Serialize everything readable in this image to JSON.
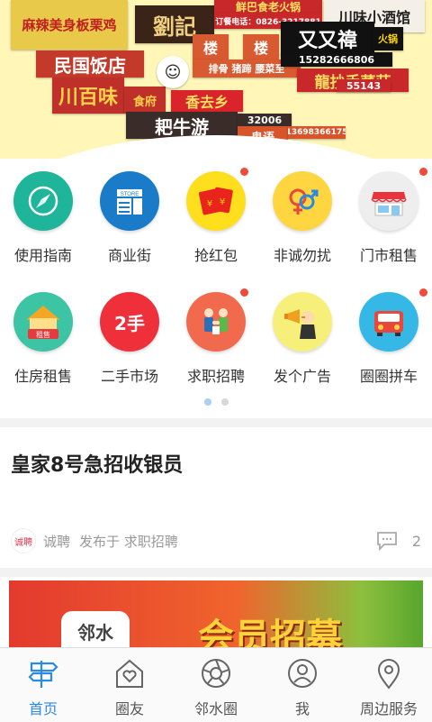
{
  "banner": {
    "signs": [
      {
        "text": "麻辣美身板栗鸡",
        "bg": "#e8c94a",
        "fg": "#c02020"
      },
      {
        "text": "劉記",
        "bg": "#3a2418",
        "fg": "#f0d080"
      },
      {
        "text": "鲜巴食老火锅",
        "bg": "#c8282a",
        "fg": "#ffe060"
      },
      {
        "text": "订餐电话：0826-3217881",
        "bg": "#c8282a",
        "fg": "#fff"
      },
      {
        "text": "川味小酒馆",
        "bg": "#f4f0e8",
        "fg": "#222"
      },
      {
        "text": "民国饭店",
        "bg": "#c43a2a",
        "fg": "#fff"
      },
      {
        "text": "楼",
        "bg": "#d85a30",
        "fg": "#fff"
      },
      {
        "text": "楼",
        "bg": "#d85a30",
        "fg": "#fff"
      },
      {
        "text": "又又禕",
        "bg": "#111",
        "fg": "#fff"
      },
      {
        "text": "火锅",
        "bg": "#111",
        "fg": "#ffd800"
      },
      {
        "text": "15282666806",
        "bg": "#111",
        "fg": "#fff"
      },
      {
        "text": "排骨 猪蹄 腰菜至",
        "bg": "#d85a30",
        "fg": "#fff"
      },
      {
        "text": "龍抄手菜莊",
        "bg": "#c8282a",
        "fg": "#ffe060"
      },
      {
        "text": "川百味",
        "bg": "#c0302a",
        "fg": "#ffd24a"
      },
      {
        "text": "食府",
        "bg": "#c0302a",
        "fg": "#ffd24a"
      },
      {
        "text": "香去乡",
        "bg": "#d8242a",
        "fg": "#ffe060"
      },
      {
        "text": "55143",
        "bg": "#c8282a",
        "fg": "#fff"
      },
      {
        "text": "耙牛游",
        "bg": "#3a2c28",
        "fg": "#fff"
      },
      {
        "text": "32006",
        "bg": "#3a2c28",
        "fg": "#fff"
      },
      {
        "text": "鬼语",
        "bg": "#d8542a",
        "fg": "#fff"
      },
      {
        "text": "13698366175",
        "bg": "#d8542a",
        "fg": "#fff"
      }
    ]
  },
  "grid": [
    {
      "label": "使用指南",
      "icon": "compass-icon",
      "color": "#1fb59a",
      "dot": false
    },
    {
      "label": "商业街",
      "icon": "store-icon",
      "color": "#1a7cc8",
      "dot": false
    },
    {
      "label": "抢红包",
      "icon": "red-envelope-icon",
      "color": "#ffde1e",
      "dot": true
    },
    {
      "label": "非诚勿扰",
      "icon": "gender-icon",
      "color": "#ffd640",
      "dot": false
    },
    {
      "label": "门市租售",
      "icon": "shopfront-icon",
      "color": "#eeeeee",
      "dot": true
    },
    {
      "label": "住房租售",
      "icon": "house-icon",
      "color": "#3cc4a4",
      "dot": false,
      "badge": "租售"
    },
    {
      "label": "二手市场",
      "icon": "secondhand-icon",
      "color": "#ef2f3a",
      "dot": false,
      "badge": "2手"
    },
    {
      "label": "求职招聘",
      "icon": "handshake-icon",
      "color": "#f26a4e",
      "dot": true
    },
    {
      "label": "发个广告",
      "icon": "megaphone-icon",
      "color": "#f6f07a",
      "dot": false
    },
    {
      "label": "圈圈拼车",
      "icon": "car-icon",
      "color": "#35b8e6",
      "dot": true
    }
  ],
  "pager": {
    "count": 2,
    "active": 0
  },
  "post": {
    "title": "皇家8号急招收银员",
    "author": "诚聘",
    "avatar_text": "诚聘",
    "published_in": "发布于 求职招聘",
    "comment_count": "2"
  },
  "ad": {
    "text": "邻水",
    "headline": "会员招募"
  },
  "nav": [
    {
      "label": "首页",
      "icon": "signpost-icon",
      "active": true
    },
    {
      "label": "圈友",
      "icon": "home-heart-icon",
      "active": false
    },
    {
      "label": "邻水圈",
      "icon": "aperture-icon",
      "active": false
    },
    {
      "label": "我",
      "icon": "profile-icon",
      "active": false
    },
    {
      "label": "周边服务",
      "icon": "location-pin-icon",
      "active": false
    }
  ],
  "colors": {
    "accent": "#2c8be0",
    "dot": "#f04a3a"
  }
}
